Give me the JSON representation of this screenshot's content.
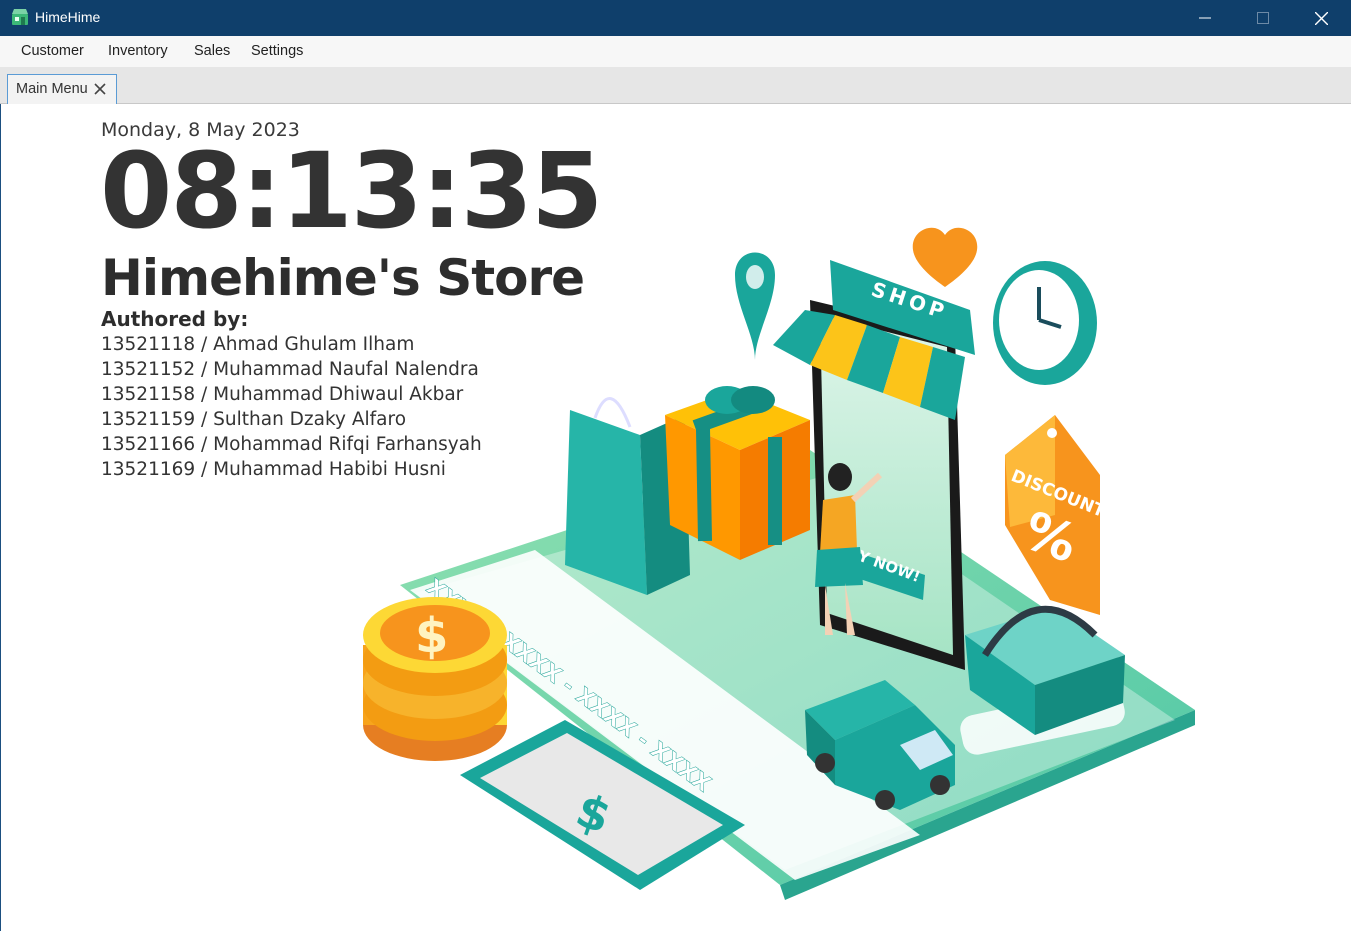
{
  "window": {
    "title": "HimeHime",
    "app_icon": "store-icon",
    "controls": [
      "minimize-icon",
      "maximize-icon",
      "close-icon"
    ]
  },
  "menu": {
    "items": [
      {
        "label": "Customer"
      },
      {
        "label": "Inventory"
      },
      {
        "label": "Sales"
      },
      {
        "label": "Settings"
      }
    ]
  },
  "tabs": [
    {
      "label": "Main Menu",
      "close_icon": "close-icon"
    }
  ],
  "main": {
    "date": "Monday, 8 May 2023",
    "time": "08:13:35",
    "store_name": "Himehime's Store",
    "authored_label": "Authored by:",
    "authors": [
      "13521118 / Ahmad Ghulam Ilham",
      "13521152 / Muhammad Naufal Nalendra",
      "13521158 / Muhammad Dhiwaul Akbar",
      "13521159 / Sulthan Dzaky Alfaro",
      "13521166 / Mohammad Rifqi Farhansyah",
      "13521169 / Muhammad Habibi Husni"
    ]
  },
  "illustration": {
    "shop_sign": "SHOP",
    "buy_button": "Y NOW!",
    "tag_text": "DISCOUNT",
    "tag_percent": "%",
    "card_number": "XXXX - XXXX - XXXX - XXXX",
    "currency_symbol": "$"
  },
  "colors": {
    "titlebar": "#0f3f6b",
    "teal": "#1aa69b",
    "orange": "#f7941d",
    "yellow": "#fcc419",
    "text_dark": "#2d2d2d"
  }
}
